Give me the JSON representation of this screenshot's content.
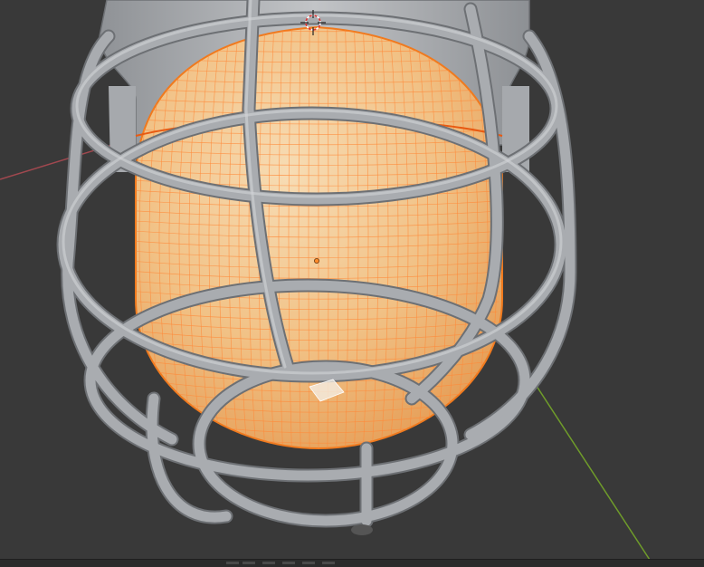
{
  "app": {
    "view": "3D Viewport"
  },
  "scene": {
    "objects": [
      {
        "name": "glass-globe",
        "selected": true,
        "display": "wireframe-on-shaded"
      },
      {
        "name": "wire-cage",
        "selected": false,
        "display": "solid"
      },
      {
        "name": "lamp-base",
        "selected": false,
        "display": "solid"
      }
    ]
  },
  "colors": {
    "viewport_bg": "#393939",
    "selection_outline": "#f07a1e",
    "wire": "#ff8a3a",
    "globe_fill": "#f3c68c",
    "cage": "#9c9fa3",
    "axis_x": "#a1484f",
    "axis_y": "#6f9c2a"
  },
  "icons": [
    "3d-cursor-icon",
    "origin-dot-icon"
  ]
}
